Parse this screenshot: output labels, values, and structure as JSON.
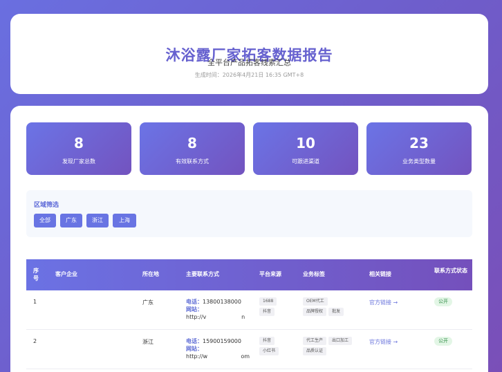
{
  "header": {
    "title": "沐浴露厂家拓客数据报告",
    "subtitle": "全平台产品拓客线索汇总",
    "generated": "生成时间：2026年4月21日 16:35 GMT+8"
  },
  "stats": [
    {
      "value": "8",
      "label": "发现厂家总数"
    },
    {
      "value": "8",
      "label": "有效联系方式"
    },
    {
      "value": "10",
      "label": "可跟进渠道"
    },
    {
      "value": "23",
      "label": "业务类型数量"
    }
  ],
  "filter": {
    "title": "区域筛选",
    "options": [
      "全部",
      "广东",
      "浙江",
      "上海"
    ]
  },
  "table": {
    "headers": [
      "序号",
      "客户企业",
      "所在地",
      "主要联系方式",
      "平台来源",
      "业务标签",
      "相关链接",
      "联系方式状态"
    ],
    "rows": [
      {
        "index": "1",
        "company": "",
        "location": "广东",
        "phone_label": "电话：",
        "phone": "13800138000",
        "site_label": "网站：",
        "site": "http://v                    n",
        "platforms": [
          "1688",
          "抖音"
        ],
        "tags": [
          "OEM代工",
          "品牌授权",
          "批发"
        ],
        "link": "官方链接 →",
        "status": "公开"
      },
      {
        "index": "2",
        "company": "",
        "location": "浙江",
        "phone_label": "电话：",
        "phone": "15900159000",
        "site_label": "网站：",
        "site": "http://w                   om",
        "platforms": [
          "抖音",
          "小红书"
        ],
        "tags": [
          "代工生产",
          "出口加工",
          "品质认证"
        ],
        "link": "官方链接 →",
        "status": "公开"
      }
    ]
  }
}
